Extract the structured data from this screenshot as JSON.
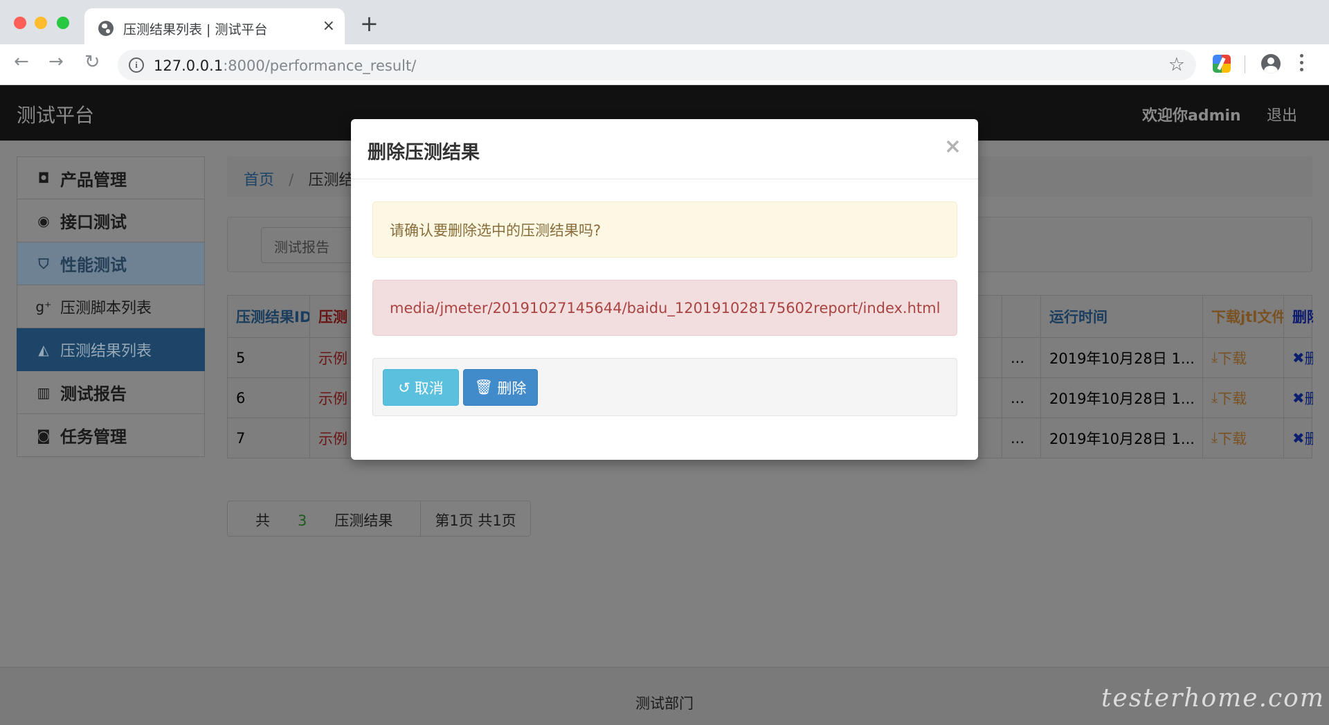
{
  "browser": {
    "tab_title": "压测结果列表 | 测试平台",
    "tab_close": "×",
    "new_tab": "+",
    "url_host": "127.0.0.1",
    "url_rest": ":8000/performance_result/"
  },
  "navbar": {
    "brand": "测试平台",
    "welcome": "欢迎你admin",
    "logout": "退出"
  },
  "sidebar": {
    "items": [
      {
        "label": "产品管理",
        "icon": "github-icon"
      },
      {
        "label": "接口测试",
        "icon": "github-circle-icon"
      },
      {
        "label": "性能测试",
        "icon": "html5-icon"
      },
      {
        "label": "压测脚本列表",
        "icon": "google-plus-icon"
      },
      {
        "label": "压测结果列表",
        "icon": "speedometer-icon"
      },
      {
        "label": "测试报告",
        "icon": "bar-chart-icon"
      },
      {
        "label": "任务管理",
        "icon": "robot-icon"
      }
    ]
  },
  "breadcrumb": {
    "home": "首页",
    "sep": "/",
    "current": "压测结果"
  },
  "filter": {
    "tab": "测试报告"
  },
  "table": {
    "headers": [
      "压测结果ID",
      "压测",
      "",
      "运行时间",
      "下载jtl文件",
      "删除"
    ],
    "rows": [
      {
        "id": "5",
        "name": "示例",
        "mid": "...",
        "time": "2019年10月28日 1...",
        "download": "下载",
        "delete": "删除"
      },
      {
        "id": "6",
        "name": "示例",
        "mid": "...",
        "time": "2019年10月28日 1...",
        "download": "下载",
        "delete": "删除"
      },
      {
        "id": "7",
        "name": "示例",
        "mid": "...",
        "time": "2019年10月28日 1...",
        "download": "下载",
        "delete": "删除"
      }
    ]
  },
  "pager": {
    "total_prefix": "共",
    "total_count": "3",
    "total_suffix": "压测结果",
    "pages": "第1页 共1页"
  },
  "footer": {
    "text": "测试部门",
    "watermark": "testerhome.com"
  },
  "modal": {
    "title": "删除压测结果",
    "close": "×",
    "confirm_text": "请确认要删除选中的压测结果吗?",
    "file_path": "media/jmeter/20191027145644/baidu_120191028175602report/index.html",
    "cancel_label": "取消",
    "delete_label": "删除"
  },
  "colors": {
    "modal_cancel": "#5bc0de",
    "modal_delete": "#428bca",
    "warning_bg": "#fcf8e3",
    "danger_bg": "#f2dede"
  }
}
